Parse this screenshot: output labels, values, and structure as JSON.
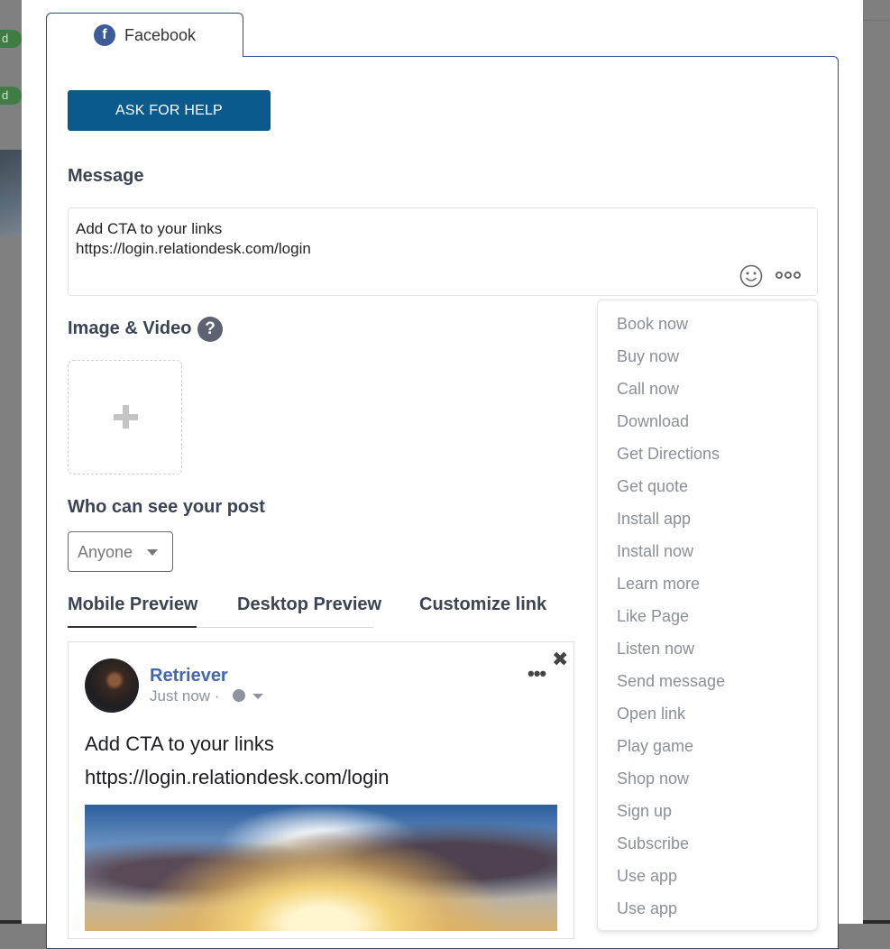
{
  "background": {
    "badges": [
      "d",
      "d"
    ]
  },
  "tabs": {
    "facebook_label": "Facebook",
    "facebook_icon_glyph": "f"
  },
  "form": {
    "help_button": "ASK FOR HELP",
    "message_label": "Message",
    "message_lines": [
      "Add CTA to your links",
      "https://login.relationdesk.com/login"
    ],
    "image_video_label": "Image & Video",
    "help_icon_glyph": "?",
    "upload_icon": "plus-icon",
    "audience_label": "Who can see your post",
    "audience_value": "Anyone"
  },
  "preview_tabs": [
    "Mobile Preview",
    "Desktop Preview",
    "Customize link"
  ],
  "preview": {
    "name": "Retriever",
    "time": "Just now ·",
    "text_lines": [
      "Add CTA to your links",
      "https://login.relationdesk.com/login"
    ],
    "more_glyph": "•••",
    "close_glyph": "✖"
  },
  "cta_menu": [
    "Book now",
    "Buy now",
    "Call now",
    "Download",
    "Get Directions",
    "Get quote",
    "Install app",
    "Install now",
    "Learn more",
    "Like Page",
    "Listen now",
    "Send message",
    "Open link",
    "Play game",
    "Shop now",
    "Sign up",
    "Subscribe",
    "Use app",
    "Use app"
  ],
  "colors": {
    "primary_button": "#0a5a8e",
    "facebook_blue": "#3b5b9a",
    "name_link": "#4267b2",
    "menu_text": "#8b8f97"
  }
}
